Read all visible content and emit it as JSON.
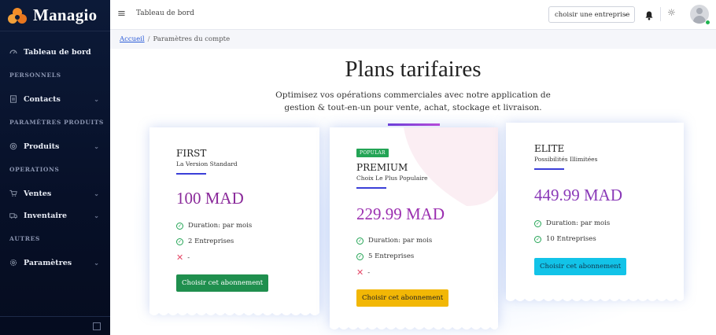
{
  "brand": {
    "name": "Managio"
  },
  "sidebar": {
    "items": [
      {
        "type": "item",
        "label": "Tableau de bord",
        "icon": "dashboard-icon"
      },
      {
        "type": "section",
        "label": "PERSONNELS"
      },
      {
        "type": "item",
        "label": "Contacts",
        "icon": "contacts-icon",
        "expandable": true
      },
      {
        "type": "section",
        "label": "PARAMÈTRES PRODUITS"
      },
      {
        "type": "item",
        "label": "Produits",
        "icon": "products-icon",
        "expandable": true
      },
      {
        "type": "section",
        "label": "OPERATIONS"
      },
      {
        "type": "item",
        "label": "Ventes",
        "icon": "cart-icon",
        "expandable": true
      },
      {
        "type": "item",
        "label": "Inventaire",
        "icon": "inventory-icon",
        "expandable": true
      },
      {
        "type": "section",
        "label": "AUTRES"
      },
      {
        "type": "item",
        "label": "Paramètres",
        "icon": "settings-icon",
        "expandable": true
      }
    ]
  },
  "topbar": {
    "title": "Tableau de bord",
    "company_select": "choisir une entreprise"
  },
  "breadcrumb": {
    "home": "Accueil",
    "current": "Paramètres du compte"
  },
  "page": {
    "title": "Plans tarifaires",
    "subtitle": "Optimisez vos opérations commerciales avec notre application de gestion & tout-en-un pour vente, achat, stockage et livraison."
  },
  "plans": [
    {
      "name": "FIRST",
      "desc": "La Version Standard",
      "price": "100 MAD",
      "features": [
        "Duration: par mois",
        "2 Entreprises"
      ],
      "excluded": "-",
      "button": "Choisir cet abonnement",
      "button_color": "#1f8f4e",
      "price_color": "#8a2a9a"
    },
    {
      "badge": "POPULAR",
      "name": "PREMIUM",
      "desc": "Choix Le Plus Populaire",
      "price": "229.99 MAD",
      "features": [
        "Duration: par mois",
        "5 Entreprises"
      ],
      "excluded": "-",
      "button": "Choisir cet abonnement",
      "button_color": "#f2b705",
      "price_color": "#9b2fb0"
    },
    {
      "name": "ELITE",
      "desc": "Possibilités Illimitées",
      "price": "449.99 MAD",
      "features": [
        "Duration: par mois",
        "10 Entreprises"
      ],
      "button": "Choisir cet abonnement",
      "button_color": "#12c3e8",
      "price_color": "#8a3ab8"
    }
  ]
}
